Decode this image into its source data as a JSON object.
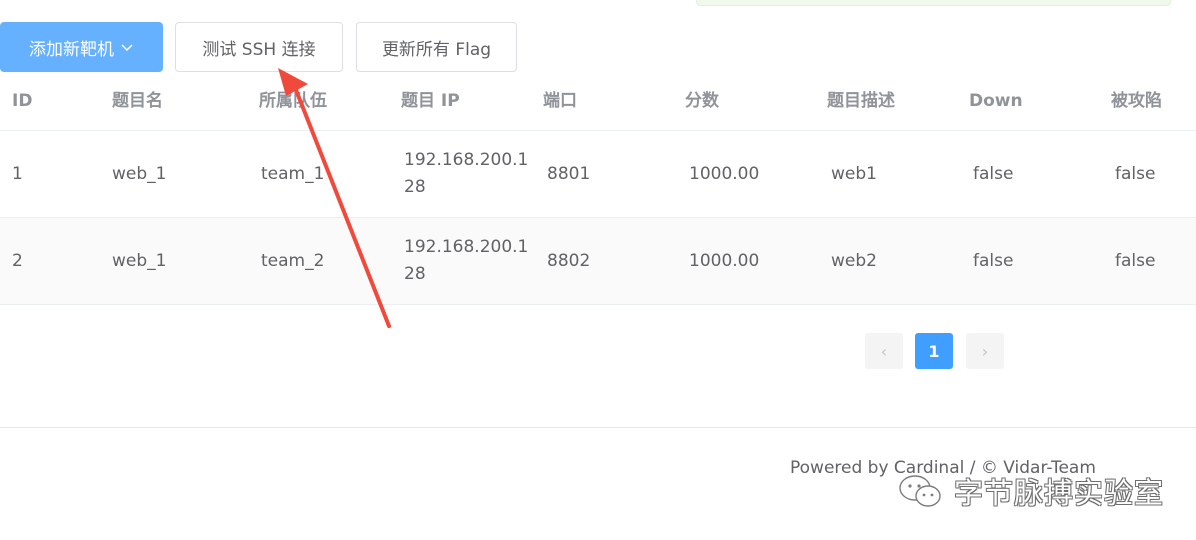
{
  "toolbar": {
    "add_target_label": "添加新靶机",
    "test_ssh_label": "测试 SSH 连接",
    "update_flags_label": "更新所有 Flag"
  },
  "table": {
    "columns": [
      "ID",
      "题目名",
      "所属队伍",
      "题目 IP",
      "端口",
      "分数",
      "题目描述",
      "Down",
      "被攻陷"
    ],
    "rows": [
      {
        "id": "1",
        "name": "web_1",
        "team": "team_1",
        "ip": "192.168.200.128",
        "port": "8801",
        "score": "1000.00",
        "desc": "web1",
        "down": "false",
        "attacked": "false"
      },
      {
        "id": "2",
        "name": "web_1",
        "team": "team_2",
        "ip": "192.168.200.128",
        "port": "8802",
        "score": "1000.00",
        "desc": "web2",
        "down": "false",
        "attacked": "false"
      }
    ]
  },
  "pagination": {
    "prev": "‹",
    "current": "1",
    "next": "›"
  },
  "footer": {
    "text": "Powered by Cardinal / © Vidar-Team"
  },
  "watermark": {
    "text": "字节脉搏实验室",
    "icon": "wechat-icon"
  },
  "colors": {
    "primary": "#409eff",
    "primary_light": "#66b1ff",
    "annotation_arrow": "#f04a3c"
  }
}
